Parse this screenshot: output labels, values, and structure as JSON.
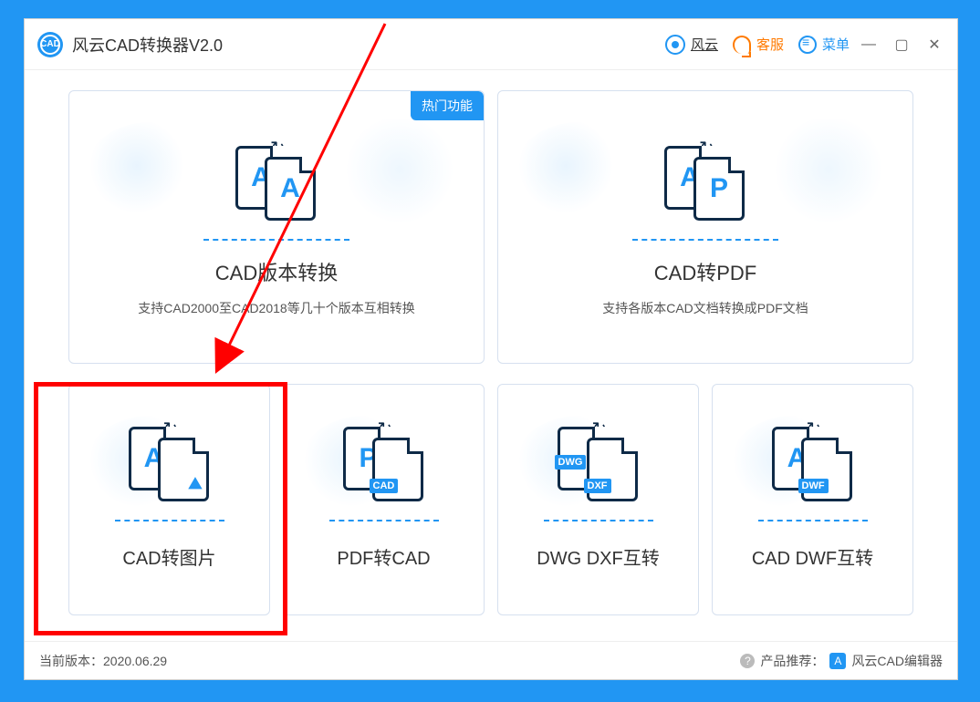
{
  "titlebar": {
    "app_title": "风云CAD转换器V2.0",
    "fengyun_label": "风云",
    "kefu_label": "客服",
    "menu_label": "菜单"
  },
  "cards": {
    "top": [
      {
        "title": "CAD版本转换",
        "desc": "支持CAD2000至CAD2018等几十个版本互相转换",
        "hot": "热门功能",
        "iconA": "A",
        "iconB": "A"
      },
      {
        "title": "CAD转PDF",
        "desc": "支持各版本CAD文档转换成PDF文档",
        "iconA": "A",
        "iconB": "P"
      }
    ],
    "bottom": [
      {
        "title": "CAD转图片",
        "iconA": "A",
        "iconB_tag": ""
      },
      {
        "title": "PDF转CAD",
        "iconA": "P",
        "iconB_tag": "CAD"
      },
      {
        "title": "DWG DXF互转",
        "iconA_tag": "DWG",
        "iconB_tag": "DXF"
      },
      {
        "title": "CAD DWF互转",
        "iconA": "A",
        "iconB_tag": "DWF"
      }
    ]
  },
  "footer": {
    "version_label": "当前版本：",
    "version_value": "2020.06.29",
    "recommend_label": "产品推荐：",
    "editor_label": "风云CAD编辑器"
  }
}
